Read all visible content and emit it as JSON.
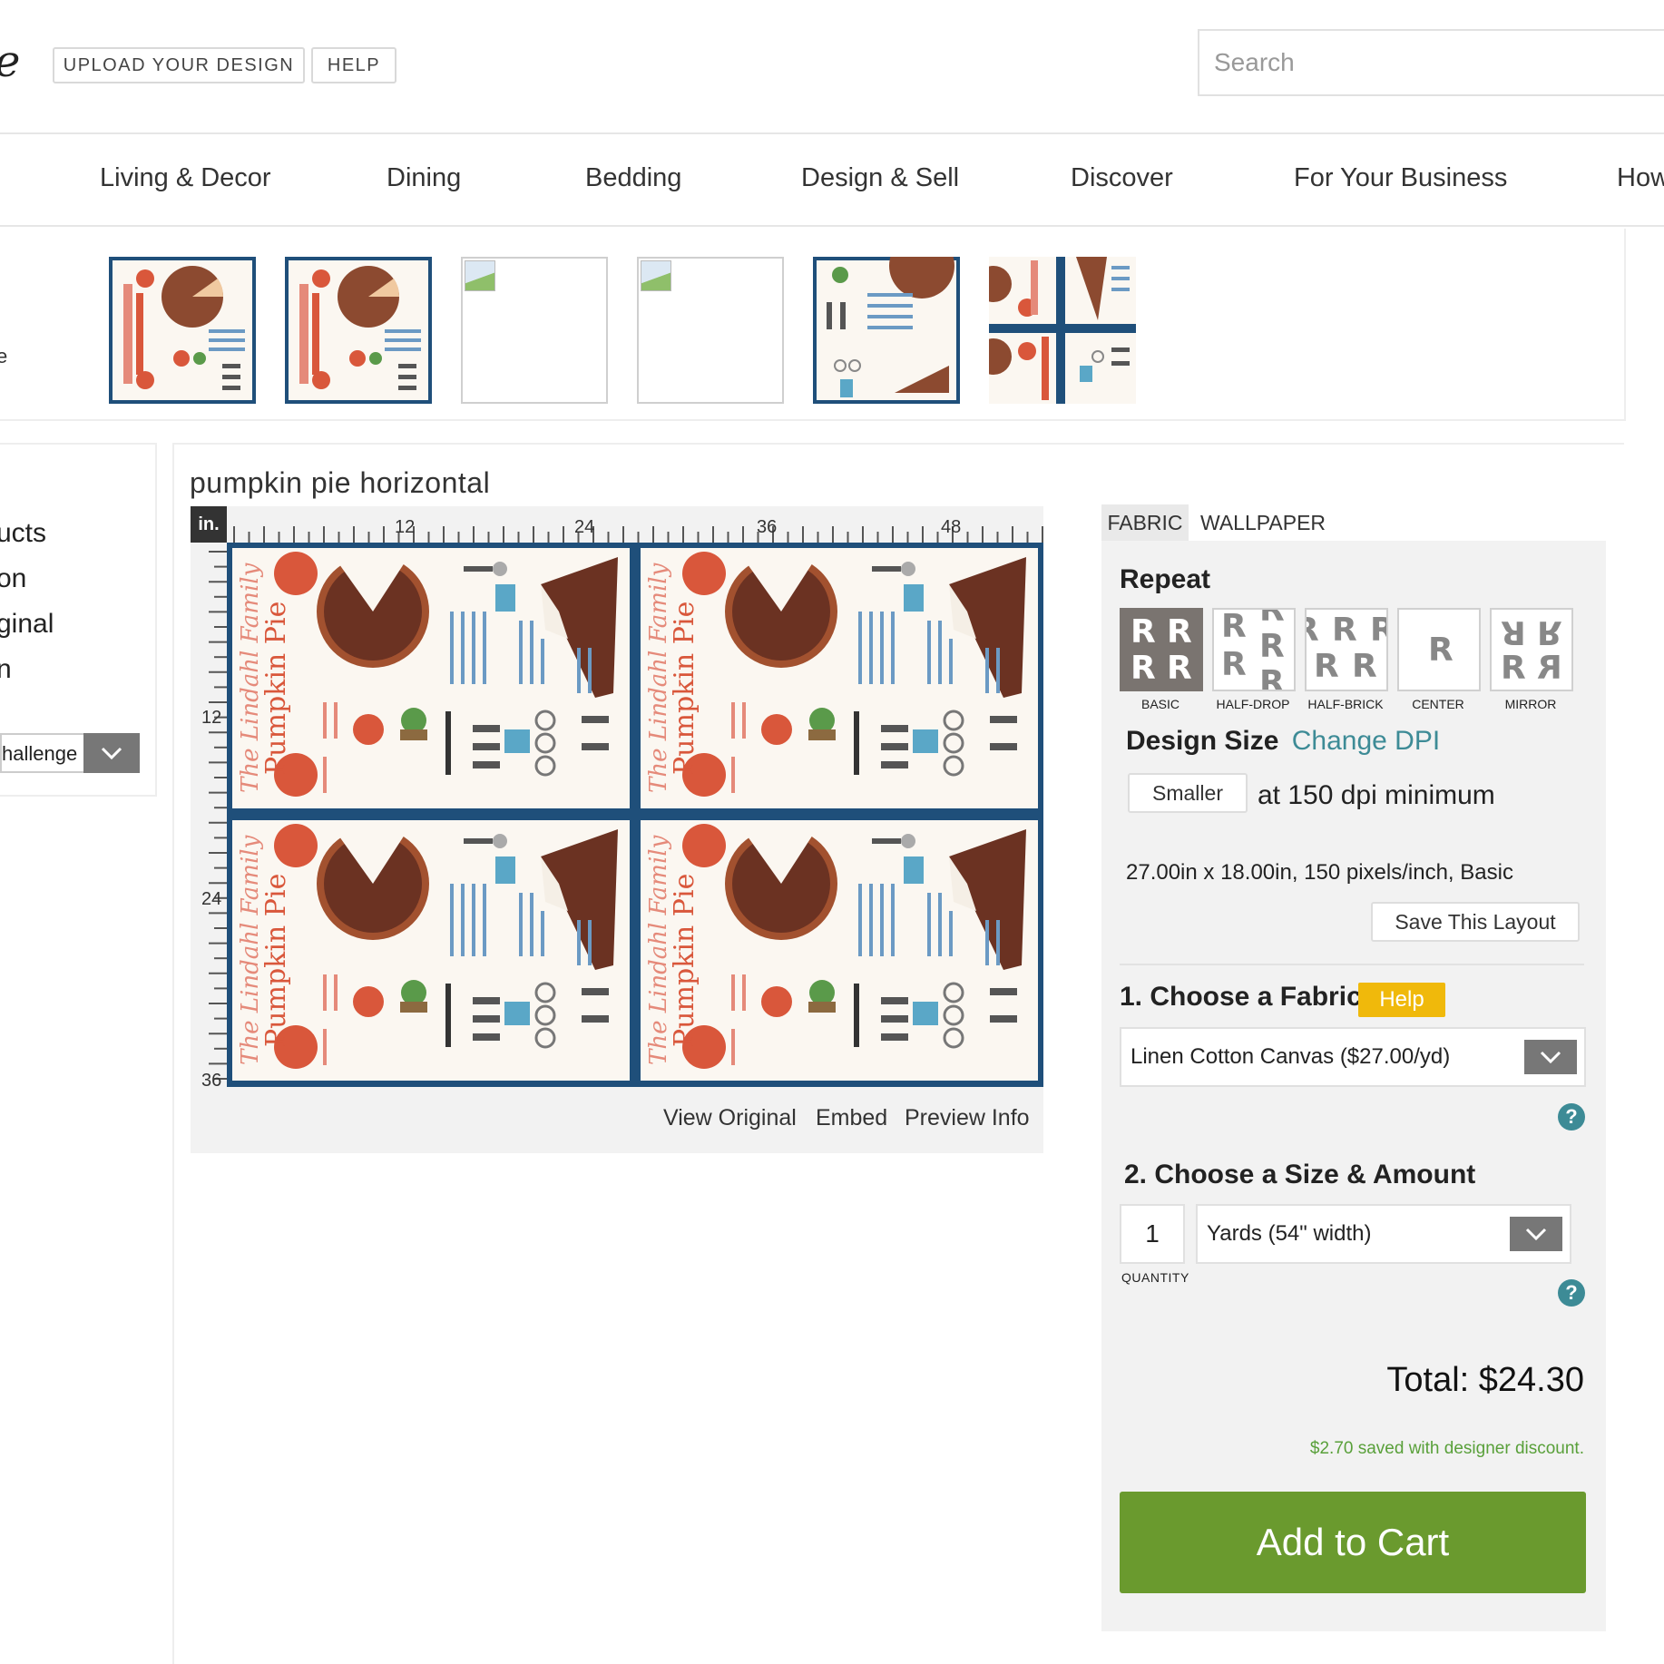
{
  "header": {
    "logo_fragment": "e",
    "upload_label": "UPLOAD YOUR DESIGN",
    "help_label": "HELP",
    "search_placeholder": "Search"
  },
  "nav": {
    "items": [
      "Living & Decor",
      "Dining",
      "Bedding",
      "Design & Sell",
      "Discover",
      "For Your Business",
      "How"
    ]
  },
  "thumbs": {
    "edge_text": "e"
  },
  "sidebar": {
    "items": [
      "ucts",
      "on",
      "ginal",
      "n"
    ],
    "challenge_label": "hallenge"
  },
  "design": {
    "title": "pumpkin pie horizontal",
    "ruler_unit": "in.",
    "ruler_top_labels": [
      "12",
      "24",
      "36",
      "48"
    ],
    "ruler_left_labels": [
      "12",
      "24",
      "36"
    ],
    "tile_script": "The Lindahl Family",
    "tile_title": "Pumpkin Pie",
    "links": [
      "View Original",
      "Embed",
      "Preview Info"
    ]
  },
  "tabs": [
    "FABRIC",
    "WALLPAPER"
  ],
  "repeat": {
    "heading": "Repeat",
    "options": [
      "BASIC",
      "HALF-DROP",
      "HALF-BRICK",
      "CENTER",
      "MIRROR"
    ],
    "selected": "BASIC"
  },
  "design_size": {
    "heading": "Design Size",
    "change_dpi": "Change DPI",
    "smaller_label": "Smaller",
    "dpi_text": "at 150 dpi minimum",
    "dimensions": "27.00in x 18.00in, 150 pixels/inch, Basic",
    "save_layout": "Save This Layout"
  },
  "fabric": {
    "heading": "1. Choose a Fabric",
    "help_label": "Help",
    "selected": "Linen Cotton Canvas ($27.00/yd)"
  },
  "size": {
    "heading": "2. Choose a Size & Amount",
    "quantity": "1",
    "quantity_label": "QUANTITY",
    "unit": "Yards (54\" width)"
  },
  "summary": {
    "total": "Total: $24.30",
    "saved": "$2.70 saved with designer discount.",
    "cart_label": "Add to Cart"
  },
  "colors": {
    "accent_teal": "#3d8b96",
    "cart_green": "#6a9a2e",
    "help_yellow": "#f0b90b",
    "fabric_blue": "#1f4f7a",
    "pie_brown": "#6b3222",
    "pumpkin_red": "#d9573b"
  }
}
